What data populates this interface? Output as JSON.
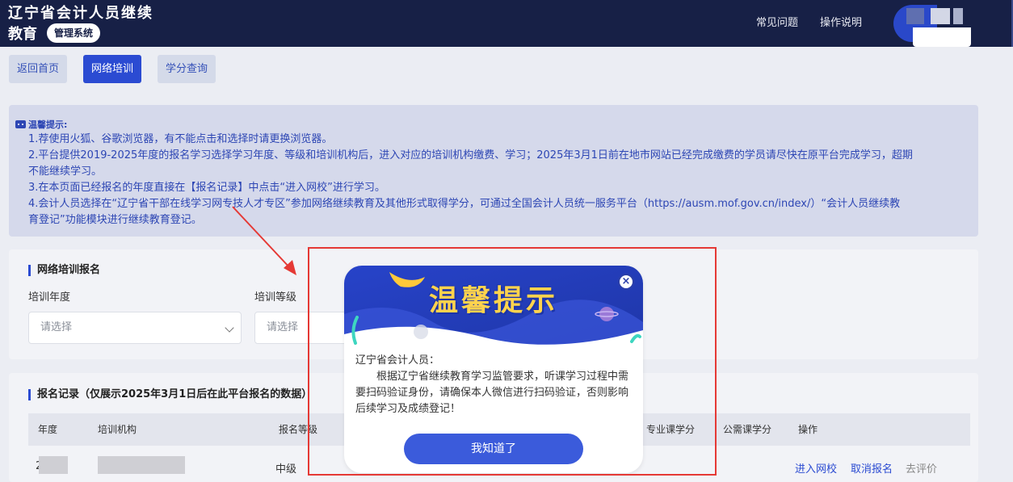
{
  "header": {
    "title_line1": "辽宁省会计人员继续",
    "title_line2": "教育",
    "badge": "管理系统",
    "nav": [
      "常见问题",
      "操作说明"
    ]
  },
  "tabs": [
    {
      "label": "返回首页",
      "active": false
    },
    {
      "label": "网络培训",
      "active": true
    },
    {
      "label": "学分查询",
      "active": false
    }
  ],
  "tips": {
    "title": "温馨提示:",
    "lines": [
      "1.荐使用火狐、谷歌浏览器，有不能点击和选择时请更换浏览器。",
      "2.平台提供2019-2025年度的报名学习选择学习年度、等级和培训机构后，进入对应的培训机构缴费、学习；2025年3月1日前在地市网站已经完成缴费的学员请尽快在原平台完成学习，超期",
      "不能继续学习。",
      "3.在本页面已经报名的年度直接在【报名记录】中点击“进入网校”进行学习。",
      "4.会计人员选择在“辽宁省干部在线学习网专技人才专区”参加网络继续教育及其他形式取得学分，可通过全国会计人员统一服务平台（https://ausm.mof.gov.cn/index/）“会计人员继续教",
      "育登记”功能模块进行继续教育登记。"
    ]
  },
  "registration": {
    "section_title": "网络培训报名",
    "fields": [
      {
        "label": "培训年度",
        "placeholder": "请选择"
      },
      {
        "label": "培训等级",
        "placeholder": "请选择"
      }
    ]
  },
  "records": {
    "section_title": "报名记录（仅展示2025年3月1日后在此平台报名的数据）",
    "columns": [
      "年度",
      "培训机构",
      "报名等级",
      "专业课学分",
      "公需课学分",
      "操作"
    ],
    "rows": [
      {
        "year": "2",
        "level": "中级",
        "actions": [
          "进入网校",
          "取消报名",
          "去评价"
        ]
      }
    ]
  },
  "modal": {
    "title": "温馨提示",
    "greeting": "辽宁省会计人员：",
    "message": "根据辽宁省继续教育学习监管要求，听课学习过程中需要扫码验证身份，请确保本人微信进行扫码验证，否则影响后续学习及成绩登记！",
    "close_symbol": "×",
    "confirm_label": "我知道了"
  },
  "colors": {
    "header_bg": "#172046",
    "accent": "#2b4bd2",
    "tips_text": "#2d46b4",
    "annotation_red": "#e53935",
    "modal_title": "#ffd34d"
  }
}
